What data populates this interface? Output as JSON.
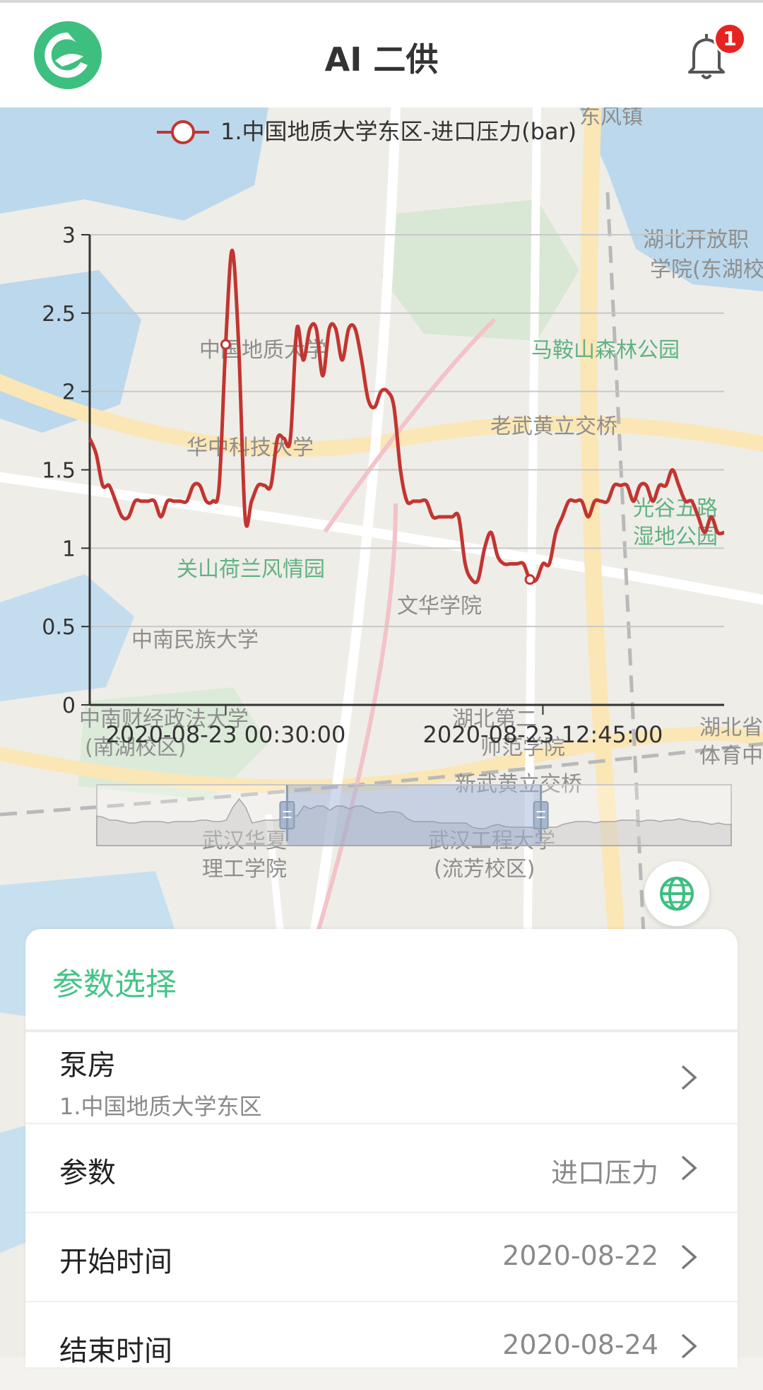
{
  "header": {
    "title": "AI 二供",
    "notification_count": "1",
    "logo_icon": "app-logo-icon",
    "bell_icon": "bell-icon"
  },
  "map": {
    "labels": [
      {
        "text": "湖北开放职",
        "cls": ""
      },
      {
        "text": "学院(东湖校",
        "cls": ""
      },
      {
        "text": "中国地质大学",
        "cls": ""
      },
      {
        "text": "马鞍山森林公园",
        "cls": "green"
      },
      {
        "text": "老武黄立交桥",
        "cls": ""
      },
      {
        "text": "华中科技大学",
        "cls": ""
      },
      {
        "text": "光谷五路",
        "cls": "green"
      },
      {
        "text": "湿地公园",
        "cls": "green"
      },
      {
        "text": "关山荷兰风情园",
        "cls": "green"
      },
      {
        "text": "文华学院",
        "cls": ""
      },
      {
        "text": "中南民族大学",
        "cls": ""
      },
      {
        "text": "中南财经政法大学",
        "cls": ""
      },
      {
        "text": "(南湖校区)",
        "cls": ""
      },
      {
        "text": "湖北第二",
        "cls": ""
      },
      {
        "text": "师范学院",
        "cls": ""
      },
      {
        "text": "湖北省",
        "cls": ""
      },
      {
        "text": "体育中",
        "cls": ""
      },
      {
        "text": "新武黄立交桥",
        "cls": ""
      },
      {
        "text": "武汉华夏",
        "cls": ""
      },
      {
        "text": "理工学院",
        "cls": ""
      },
      {
        "text": "武汉工程大学",
        "cls": ""
      },
      {
        "text": "(流芳校区)",
        "cls": ""
      },
      {
        "text": "东风镇",
        "cls": ""
      }
    ]
  },
  "chart_data": {
    "type": "line",
    "title": "",
    "legend": "1.中国地质大学东区-进口压力(bar)",
    "series": [
      {
        "name": "1.中国地质大学东区-进口压力(bar)",
        "color": "#c23531",
        "values": [
          1.7,
          1.6,
          1.4,
          1.4,
          1.3,
          1.2,
          1.2,
          1.3,
          1.3,
          1.3,
          1.3,
          1.2,
          1.3,
          1.3,
          1.3,
          1.3,
          1.4,
          1.4,
          1.3,
          1.3,
          1.4,
          2.3,
          2.9,
          2.3,
          1.2,
          1.3,
          1.4,
          1.4,
          1.4,
          1.7,
          1.7,
          1.7,
          2.4,
          2.2,
          2.4,
          2.4,
          2.1,
          2.4,
          2.4,
          2.2,
          2.4,
          2.4,
          2.2,
          1.95,
          1.9,
          2.0,
          2.0,
          1.9,
          1.5,
          1.3,
          1.3,
          1.3,
          1.3,
          1.2,
          1.2,
          1.2,
          1.2,
          1.2,
          0.9,
          0.8,
          0.8,
          1.0,
          1.1,
          0.95,
          0.9,
          0.9,
          0.9,
          0.9,
          0.8,
          0.8,
          0.9,
          0.9,
          1.1,
          1.2,
          1.3,
          1.3,
          1.3,
          1.2,
          1.3,
          1.3,
          1.3,
          1.4,
          1.4,
          1.4,
          1.3,
          1.4,
          1.4,
          1.3,
          1.4,
          1.4,
          1.5,
          1.4,
          1.3,
          1.3,
          1.2,
          1.1,
          1.2,
          1.1,
          1.1
        ]
      }
    ],
    "x_ticks": [
      {
        "label": "2020-08-23 00:30:00",
        "index": 21
      },
      {
        "label": "2020-08-23 12:45:00",
        "index": 70
      }
    ],
    "highlight_points": [
      21,
      68
    ],
    "ylim": [
      0,
      3
    ],
    "y_ticks": [
      "0",
      "0.5",
      "1",
      "1.5",
      "2",
      "2.5",
      "3"
    ],
    "grid": true,
    "legend_position": "top",
    "datazoom_range": [
      0.3,
      0.7
    ]
  },
  "panel": {
    "title": "参数选择",
    "rows": [
      {
        "label": "泵房",
        "sub": "1.中国地质大学东区",
        "value": ""
      },
      {
        "label": "参数",
        "value": "进口压力"
      },
      {
        "label": "开始时间",
        "value": "2020-08-22"
      },
      {
        "label": "结束时间",
        "value": "2020-08-24"
      }
    ]
  },
  "colors": {
    "accent": "#45c488",
    "line": "#c23531",
    "badge": "#e52421"
  }
}
